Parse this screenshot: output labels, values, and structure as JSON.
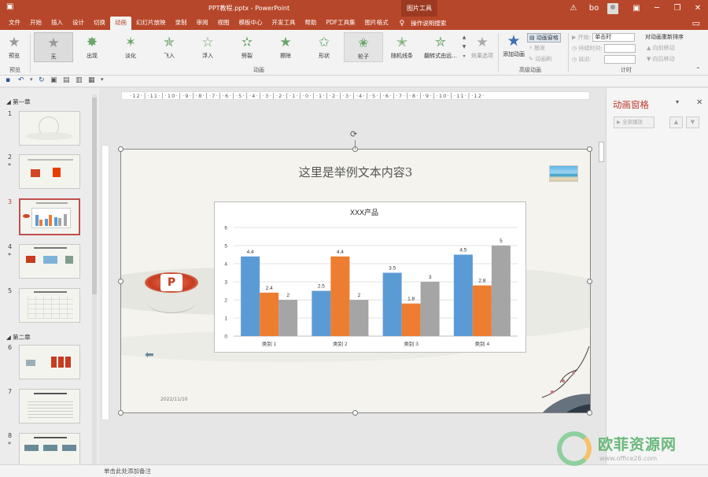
{
  "titlebar": {
    "title": "PPT教程.pptx  -  PowerPoint",
    "context_group": "图片工具",
    "user": "bo"
  },
  "tabs": [
    "文件",
    "开始",
    "插入",
    "设计",
    "切换",
    "动画",
    "幻灯片放映",
    "录制",
    "审阅",
    "视图",
    "模板中心",
    "开发工具",
    "帮助",
    "PDF工具集",
    "图片格式"
  ],
  "active_tab": "动画",
  "tell_me": "操作说明搜索",
  "ribbon": {
    "preview_label": "预览",
    "preview_group": "预览",
    "effects": [
      "无",
      "出现",
      "淡化",
      "飞入",
      "浮入",
      "劈裂",
      "擦除",
      "形状",
      "轮子",
      "随机线条",
      "翻转式由远..."
    ],
    "effect_options": "效果选项",
    "anim_group": "动画",
    "add_animation": "添加动画",
    "animation_pane": "动画窗格",
    "trigger": "触发",
    "anim_painter": "动画刷",
    "adv_group": "高级动画",
    "start_label": "开始:",
    "start_value": "单击时",
    "duration_label": "持续时间:",
    "delay_label": "延迟:",
    "timing_group": "计时",
    "reorder_title": "对动画重新排序",
    "move_earlier": "向前移动",
    "move_later": "向后移动"
  },
  "thumbs": {
    "section1": "第一章",
    "section2": "第二章",
    "slides": [
      "1",
      "2",
      "3",
      "4",
      "5",
      "6",
      "7",
      "8"
    ]
  },
  "ruler_labels": "·12·│·11·│·10·│·9·│·8·│·7·│·6·│·5·│·4·│·3·│·2·│·1·│·0·│·1·│·2·│·3·│·4·│·5·│·6·│·7·│·8·│·9·│·10·│·11·│·12·",
  "slide": {
    "title": "这里是举例文本内容3",
    "date": "2022/11/10"
  },
  "chart_data": {
    "type": "bar",
    "title": "XXX产品",
    "categories": [
      "类别 1",
      "类别 2",
      "类别 3",
      "类别 4"
    ],
    "series": [
      {
        "values": [
          4.4,
          2.5,
          3.5,
          4.5
        ],
        "color": "#5b9bd5"
      },
      {
        "values": [
          2.4,
          4.4,
          1.8,
          2.8
        ],
        "color": "#ed7d31"
      },
      {
        "values": [
          2,
          2,
          3,
          5
        ],
        "color": "#a5a5a5"
      }
    ],
    "ylim": [
      0,
      6
    ],
    "yticks": [
      0,
      1,
      2,
      3,
      4,
      5,
      6
    ],
    "grid": true,
    "legend": "none"
  },
  "anim_pane": {
    "title": "动画窗格",
    "play_all": "全部播放"
  },
  "status": {
    "notes": "单击此处添加备注"
  },
  "watermark": {
    "text": "欧菲资源网",
    "url": "www.office26.com"
  }
}
